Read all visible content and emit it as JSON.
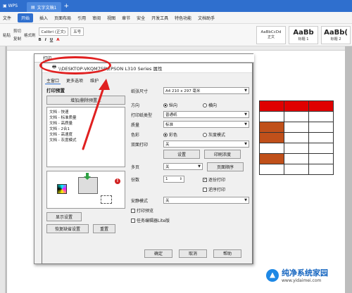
{
  "titlebar": {
    "app_tab": "WPS",
    "doc_tab": "文字文稿1",
    "new_tab": "+"
  },
  "menu": [
    "文件",
    "开始",
    "插入",
    "页面布局",
    "引用",
    "审阅",
    "视图",
    "章节",
    "安全",
    "开发工具",
    "特色功能",
    "文档助手"
  ],
  "ribbon": {
    "cut": "剪切",
    "paste": "粘贴",
    "copy": "复制",
    "format_painter": "格式刷",
    "font_name": "Calibri (正文)",
    "font_size": "五号",
    "styles": [
      {
        "big": "AaBbCcDd",
        "label": "正文"
      },
      {
        "big": "AaBb",
        "label": "标题 1"
      },
      {
        "big": "AaBb(",
        "label": "标题 2"
      }
    ]
  },
  "dialog": {
    "outer_title": "打印",
    "title": "\\\\DESKTOP-VKQM7SP\\EPSON L310 Series 属性",
    "tabs": [
      "主窗口",
      "更多选项",
      "维护"
    ],
    "preset_label": "打印预置",
    "add_delete_btn": "增加/删除预置...",
    "presets": [
      "文档 - 快速",
      "文档 - 标准质量",
      "文档 - 高质量",
      "文档 - 2合1",
      "文档 - 高速度",
      "文档 - 灰度模式"
    ],
    "show_settings_btn": "显示设置",
    "restore_defaults_btn": "恢复缺省设置",
    "reset_btn": "重置",
    "settings": {
      "paper_size_label": "纸张尺寸",
      "paper_size_value": "A4 210 x 297 毫米",
      "orientation_label": "方向",
      "portrait": "纵向",
      "landscape": "横向",
      "paper_type_label": "打印纸类型",
      "paper_type_value": "普通纸",
      "quality_label": "质量",
      "quality_value": "标准",
      "color_label": "色彩",
      "color_value": "彩色",
      "grayscale": "灰度模式",
      "duplex_label": "双面打印",
      "duplex_value": "关",
      "settings_btn": "设置",
      "print_density_btn": "印刷浓度",
      "multi_page_label": "多页",
      "multi_page_value": "关",
      "page_order_btn": "页面顺序",
      "copies_label": "份数",
      "copies_value": "1",
      "collate": "逐份打印",
      "reverse": "逆序打印",
      "quiet_mode_label": "安静模式",
      "quiet_mode_value": "关",
      "print_preview": "打印预览",
      "job_arranger": "任务编辑器Lite版"
    },
    "ok_btn": "确定",
    "cancel_btn": "取消",
    "help_btn": "帮助"
  },
  "watermark": {
    "title": "纯净系统家园",
    "url": "www.yidaimei.com"
  },
  "colors": {
    "accent": "#2f6fce",
    "table_red": "#e00000",
    "table_brown": "#c0501a",
    "highlight": "#e02020"
  }
}
